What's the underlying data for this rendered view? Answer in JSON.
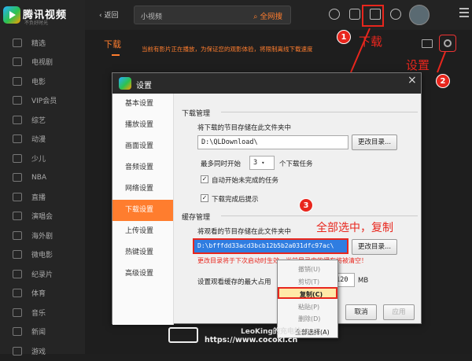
{
  "app": {
    "name": "腾讯视频",
    "slogan": "不负好时光"
  },
  "sidebar": {
    "items": [
      {
        "label": "精选"
      },
      {
        "label": "电视剧"
      },
      {
        "label": "电影"
      },
      {
        "label": "VIP会员"
      },
      {
        "label": "综艺"
      },
      {
        "label": "动漫"
      },
      {
        "label": "少儿"
      },
      {
        "label": "NBA"
      },
      {
        "label": "直播"
      },
      {
        "label": "演唱会"
      },
      {
        "label": "海外剧"
      },
      {
        "label": "微电影"
      },
      {
        "label": "纪录片"
      },
      {
        "label": "体育"
      },
      {
        "label": "音乐"
      },
      {
        "label": "新闻"
      },
      {
        "label": "游戏"
      }
    ]
  },
  "topbar": {
    "back_label": "返回",
    "search_placeholder": "小视频",
    "search_all": "全网搜"
  },
  "page": {
    "title": "下载",
    "notice": "当前有影片正在播放，为保证您的观影体验，将限制离线下载速度"
  },
  "annotations": {
    "n1": "1",
    "n2": "2",
    "n3": "3",
    "download_label": "下载",
    "settings_label": "设置",
    "copy_hint": "全部选中，复制"
  },
  "dialog": {
    "title": "设置",
    "close": "×",
    "tabs": [
      {
        "label": "基本设置"
      },
      {
        "label": "播放设置"
      },
      {
        "label": "画面设置"
      },
      {
        "label": "音频设置"
      },
      {
        "label": "网络设置"
      },
      {
        "label": "下载设置"
      },
      {
        "label": "上传设置"
      },
      {
        "label": "热键设置"
      },
      {
        "label": "高级设置"
      }
    ],
    "download": {
      "section": "下载管理",
      "path_label": "将下载的节目存储在此文件夹中",
      "path_value": "D:\\QLDownload\\",
      "change_dir": "更改目录...",
      "max_prefix": "最多同时开始",
      "max_value": "3",
      "max_suffix": "个下载任务",
      "auto_start": "自动开始未完成的任务",
      "notify": "下载完成后提示"
    },
    "cache": {
      "section": "缓存管理",
      "path_label": "将观看的节目存储在此文件夹中",
      "path_value": "D:\\bfffdd33acd3bcb12b5b2a031dfc97ac\\",
      "change_dir": "更改目录...",
      "warning": "更改目录将于下次启动时生效，当前目录中的缓存将被清空！",
      "max_prefix": "设置观看缓存的最大占用",
      "max_value": "5120",
      "max_unit": "MB"
    },
    "buttons": {
      "cancel": "取消",
      "apply": "应用"
    }
  },
  "context_menu": {
    "items": [
      {
        "label": "撤销(U)"
      },
      {
        "label": "剪切(T)"
      },
      {
        "label": "复制(C)"
      },
      {
        "label": "粘贴(P)"
      },
      {
        "label": "删除(D)"
      },
      {
        "label": "全部选择(A)"
      }
    ]
  },
  "watermark": {
    "line1": "LeoKing的充电站",
    "line2": "https://www.cocokl.cn"
  }
}
